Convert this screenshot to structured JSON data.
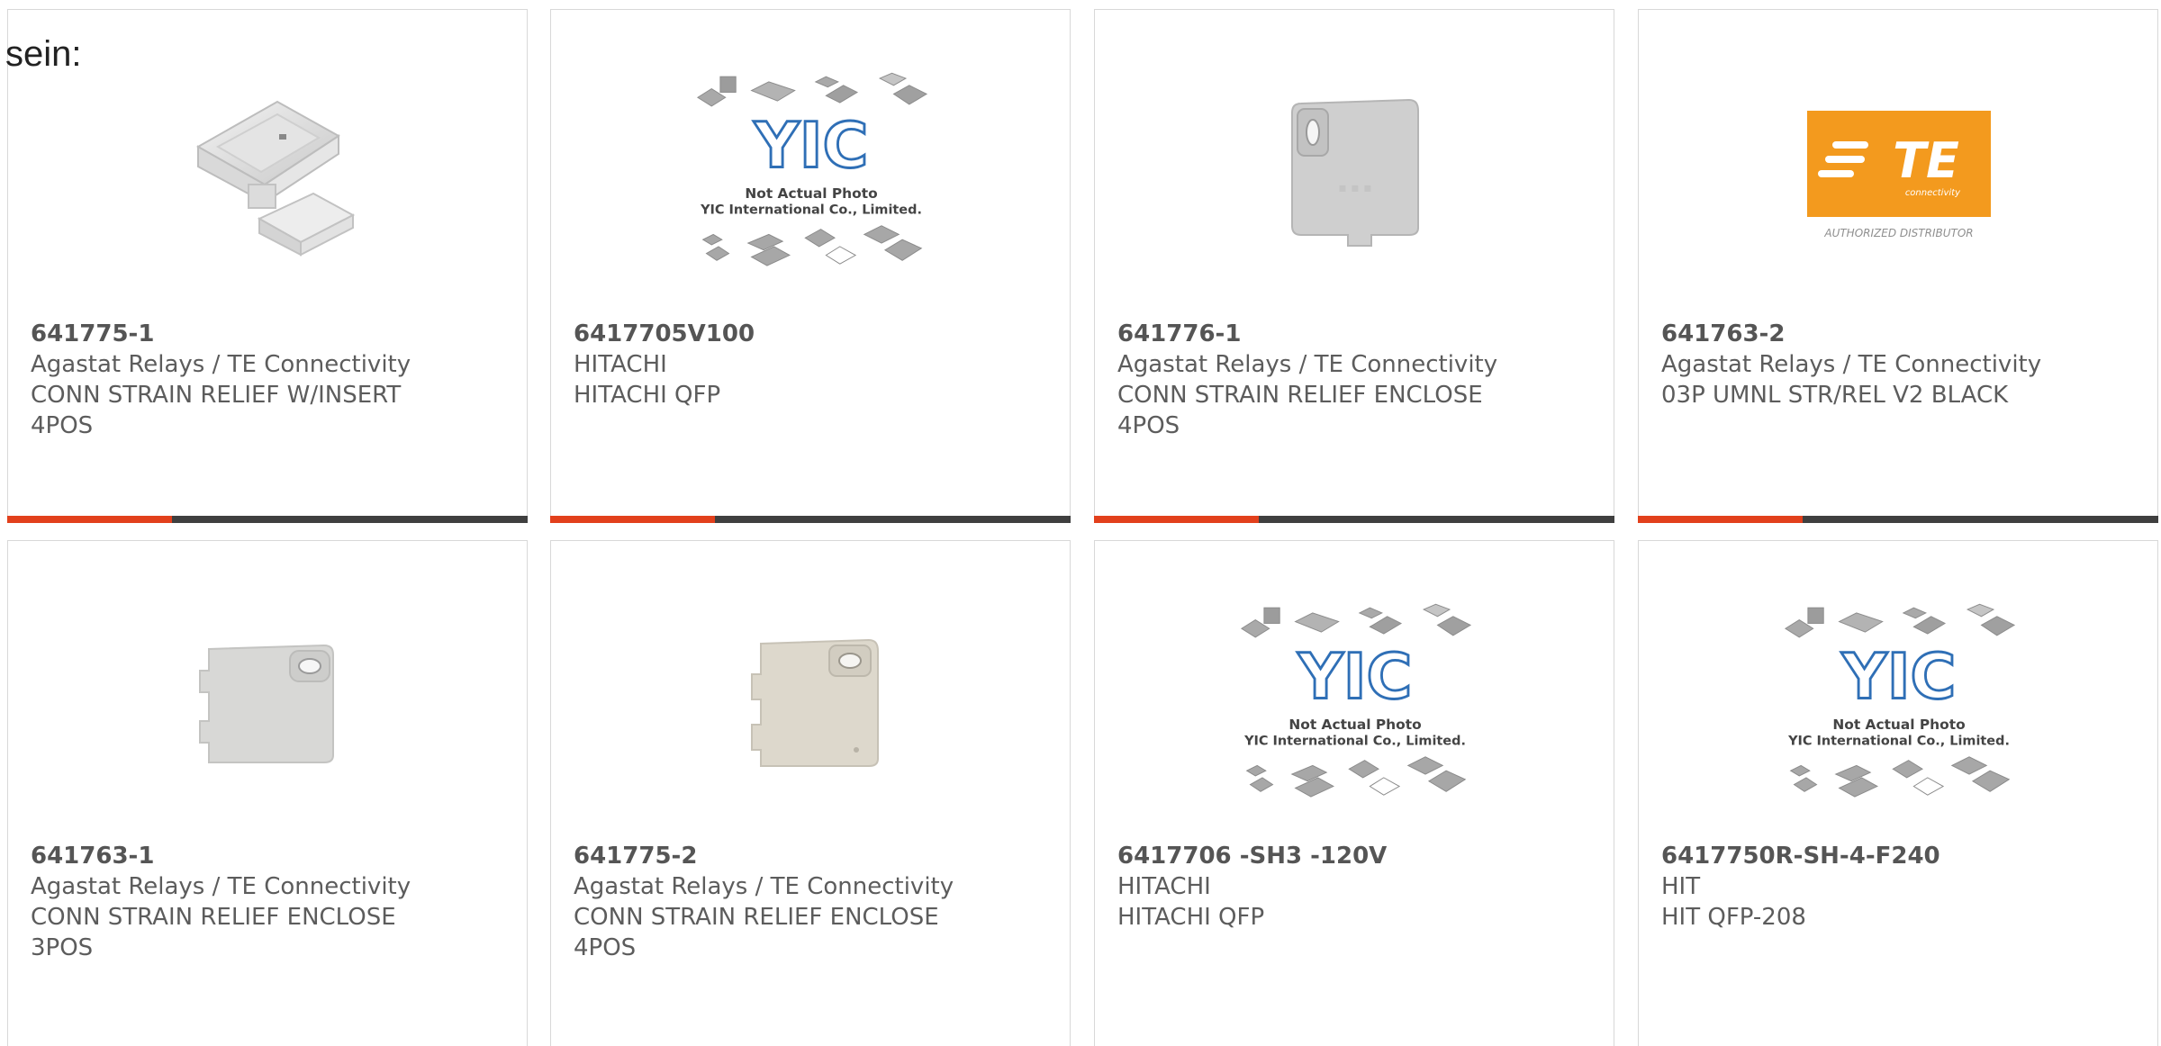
{
  "lead_text": "sein:",
  "colors": {
    "accent_bar": "#e2401c",
    "bar": "#3f3f3f",
    "te_orange": "#f39a1e"
  },
  "products": [
    {
      "part_number": "641775-1",
      "manufacturer": "Agastat Relays / TE Connectivity",
      "description": "CONN STRAIN RELIEF W/INSERT\n4POS",
      "image": "strain-relief-insert"
    },
    {
      "part_number": "6417705V100",
      "manufacturer": "HITACHI",
      "description": "HITACHI QFP",
      "image": "yic-placeholder"
    },
    {
      "part_number": "641776-1",
      "manufacturer": "Agastat Relays / TE Connectivity",
      "description": "CONN STRAIN RELIEF ENCLOSE\n4POS",
      "image": "strain-relief-enclose"
    },
    {
      "part_number": "641763-2",
      "manufacturer": "Agastat Relays / TE Connectivity",
      "description": "03P UMNL STR/REL V2 BLACK",
      "image": "te-logo"
    },
    {
      "part_number": "641763-1",
      "manufacturer": "Agastat Relays / TE Connectivity",
      "description": "CONN STRAIN RELIEF ENCLOSE\n3POS",
      "image": "strain-relief-enclose-3pos"
    },
    {
      "part_number": "641775-2",
      "manufacturer": "Agastat Relays / TE Connectivity",
      "description": "CONN STRAIN RELIEF ENCLOSE\n4POS",
      "image": "strain-relief-enclose-4pos"
    },
    {
      "part_number": "6417706 -SH3 -120V",
      "manufacturer": "HITACHI",
      "description": "HITACHI QFP",
      "image": "yic-placeholder"
    },
    {
      "part_number": "6417750R-SH-4-F240",
      "manufacturer": "HIT",
      "description": "HIT QFP-208",
      "image": "yic-placeholder"
    }
  ],
  "yic": {
    "brand": "YIC",
    "line1": "Not Actual Photo",
    "line2": "YIC International Co., Limited."
  },
  "te": {
    "brand": "TE",
    "tagline": "connectivity",
    "distributor": "AUTHORIZED DISTRIBUTOR"
  }
}
